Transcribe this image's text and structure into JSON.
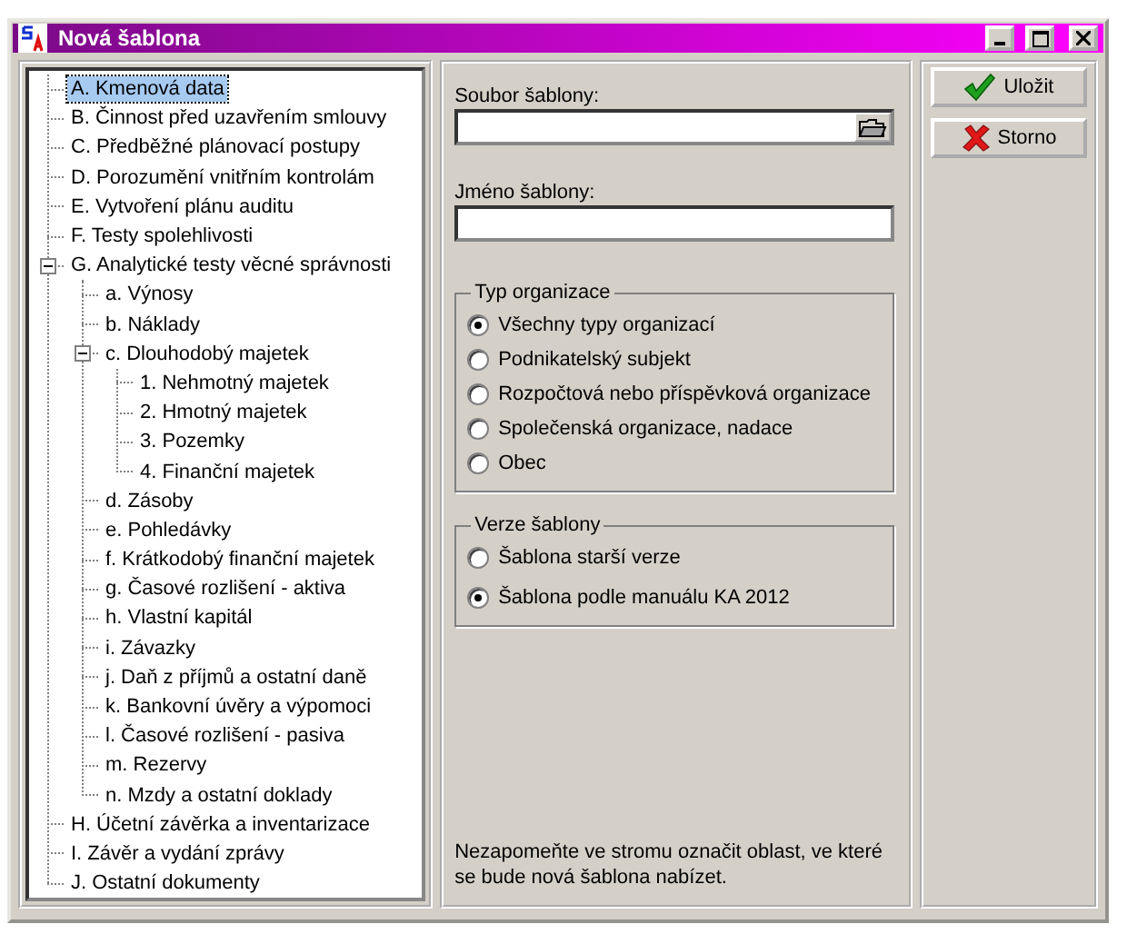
{
  "window": {
    "title": "Nová šablona"
  },
  "tree": [
    {
      "label": "A. Kmenová data",
      "selected": true
    },
    {
      "label": "B. Činnost před uzavřením smlouvy",
      "selected": false
    },
    {
      "label": "C. Předběžné plánovací postupy",
      "selected": false
    },
    {
      "label": "D. Porozumění vnitřním kontrolám",
      "selected": false
    },
    {
      "label": "E. Vytvoření plánu auditu",
      "selected": false
    },
    {
      "label": "F. Testy spolehlivosti",
      "selected": false
    },
    {
      "label": "G. Analytické testy věcné správnosti",
      "selected": false,
      "expanded": true,
      "children": [
        {
          "label": "a. Výnosy",
          "selected": false
        },
        {
          "label": "b. Náklady",
          "selected": false
        },
        {
          "label": "c. Dlouhodobý majetek",
          "selected": false,
          "expanded": true,
          "children": [
            {
              "label": "1. Nehmotný majetek",
              "selected": false
            },
            {
              "label": "2. Hmotný majetek",
              "selected": false
            },
            {
              "label": "3. Pozemky",
              "selected": false
            },
            {
              "label": "4. Finanční majetek",
              "selected": false
            }
          ]
        },
        {
          "label": "d. Zásoby",
          "selected": false
        },
        {
          "label": "e. Pohledávky",
          "selected": false
        },
        {
          "label": "f. Krátkodobý finanční majetek",
          "selected": false
        },
        {
          "label": "g. Časové rozlišení - aktiva",
          "selected": false
        },
        {
          "label": "h. Vlastní kapitál",
          "selected": false
        },
        {
          "label": "i. Závazky",
          "selected": false
        },
        {
          "label": "j. Daň z příjmů a ostatní daně",
          "selected": false
        },
        {
          "label": "k. Bankovní úvěry a výpomoci",
          "selected": false
        },
        {
          "label": "l. Časové rozlišení - pasiva",
          "selected": false
        },
        {
          "label": "m. Rezervy",
          "selected": false
        },
        {
          "label": "n. Mzdy a ostatní doklady",
          "selected": false
        }
      ]
    },
    {
      "label": "H. Účetní závěrka a inventarizace",
      "selected": false
    },
    {
      "label": "I. Závěr a vydání zprávy",
      "selected": false
    },
    {
      "label": "J. Ostatní dokumenty",
      "selected": false
    }
  ],
  "fields": {
    "template_file": {
      "label": "Soubor šablony:"
    },
    "template_name": {
      "label": "Jméno šablony:"
    }
  },
  "groups": [
    {
      "title": "Typ organizace",
      "options": [
        {
          "label": "Všechny typy organizací",
          "selected": true
        },
        {
          "label": "Podnikatelský subjekt",
          "selected": false
        },
        {
          "label": "Rozpočtová nebo příspěvková organizace",
          "selected": false
        },
        {
          "label": "Společenská organizace, nadace",
          "selected": false
        },
        {
          "label": "Obec",
          "selected": false
        }
      ]
    },
    {
      "title": "Verze šablony",
      "options": [
        {
          "label": "Šablona starší verze",
          "selected": false
        },
        {
          "label": "Šablona podle manuálu KA 2012",
          "selected": true
        }
      ]
    }
  ],
  "note": "Nezapomeňte ve stromu označit oblast, ve které se bude nová šablona nabízet.",
  "buttons": [
    {
      "kind": "save",
      "label": "Uložit"
    },
    {
      "kind": "cancel",
      "label": "Storno"
    }
  ]
}
